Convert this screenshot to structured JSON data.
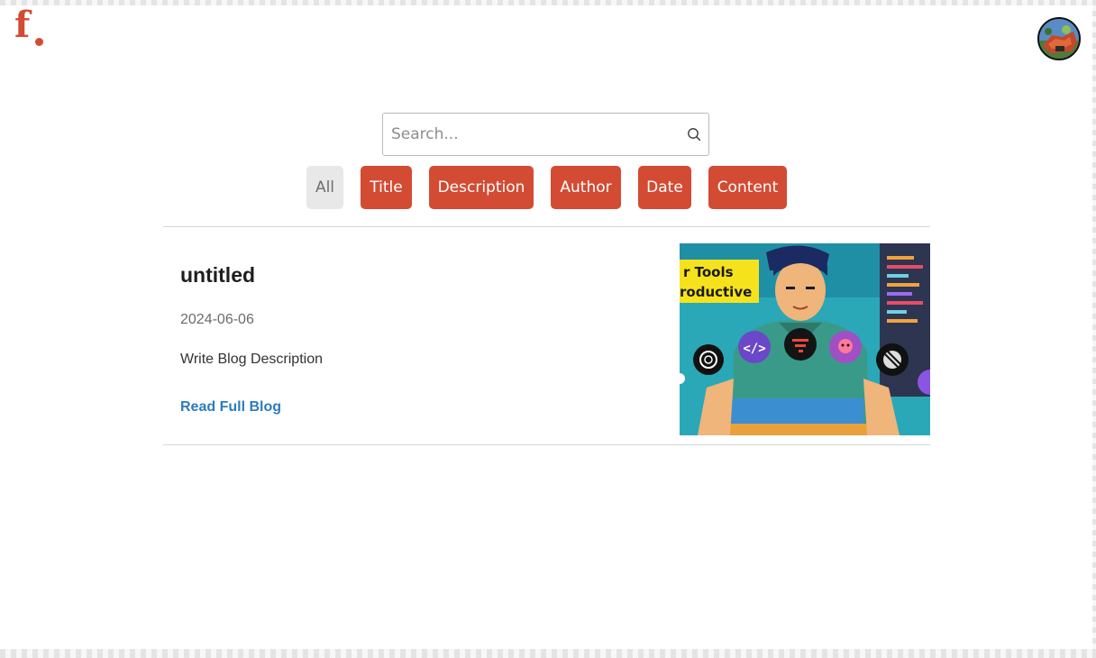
{
  "header": {
    "logo_text": "f",
    "brand_color": "#d34b33",
    "avatar_icon": "user-avatar-icon"
  },
  "search": {
    "placeholder": "Search...",
    "value": "",
    "icon": "search-icon"
  },
  "filters": {
    "all_label": "All",
    "title_label": "Title",
    "description_label": "Description",
    "author_label": "Author",
    "date_label": "Date",
    "content_label": "Content",
    "active": "All",
    "button_color": "#d34b33",
    "active_color": "#e8e8e8"
  },
  "blog": {
    "title": "untitled",
    "date": "2024-06-06",
    "description": "Write Blog Description",
    "link_label": "Read Full Blog",
    "link_color": "#2c7cbf",
    "thumbnail": {
      "banner_line_1": "r Tools",
      "banner_line_2": "roductive",
      "icons": [
        "openai-icon",
        "code-icon",
        "tool-icon",
        "ai-assistant-icon",
        "linear-icon"
      ]
    }
  }
}
